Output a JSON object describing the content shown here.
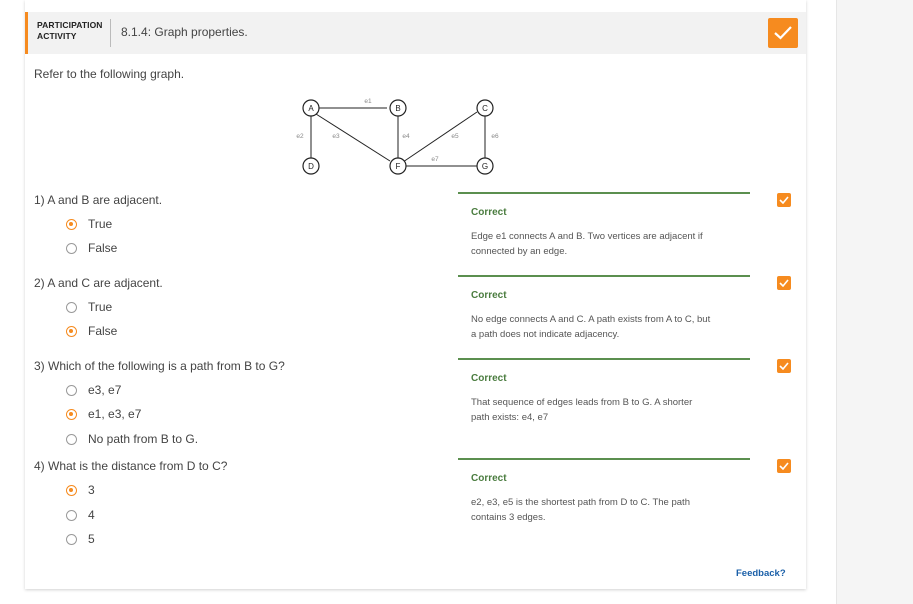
{
  "activity": {
    "label_line1": "PARTICIPATION",
    "label_line2": "ACTIVITY",
    "title": "8.1.4: Graph properties."
  },
  "intro": "Refer to the following graph.",
  "graph": {
    "vertices": [
      "A",
      "B",
      "C",
      "D",
      "F",
      "G"
    ],
    "edges": [
      "e1",
      "e2",
      "e3",
      "e4",
      "e5",
      "e6",
      "e7"
    ]
  },
  "questions": [
    {
      "prompt": "1)  A and B are adjacent.",
      "options": [
        "True",
        "False"
      ],
      "selected": 0,
      "feedback": {
        "title": "Correct",
        "line1": "Edge e1 connects A and B. Two vertices are adjacent if",
        "line2": "connected by an edge."
      }
    },
    {
      "prompt": "2)  A and C are adjacent.",
      "options": [
        "True",
        "False"
      ],
      "selected": 1,
      "feedback": {
        "title": "Correct",
        "line1": "No edge connects A and C. A path exists from A to C, but",
        "line2": "a path does not indicate adjacency."
      }
    },
    {
      "prompt": "3)  Which of the following is a path from B to G?",
      "options": [
        "e3, e7",
        "e1, e3, e7",
        "No path from B to G."
      ],
      "selected": 1,
      "feedback": {
        "title": "Correct",
        "line1": "That sequence of edges leads from B to G. A shorter",
        "line2": "path exists: e4, e7"
      }
    },
    {
      "prompt": "4)  What is the distance from D to C?",
      "options": [
        "3",
        "4",
        "5"
      ],
      "selected": 0,
      "feedback": {
        "title": "Correct",
        "line1": "e2, e3, e5 is the shortest path from D to C. The path",
        "line2": "contains 3 edges."
      }
    }
  ],
  "feedback_link": "Feedback?",
  "colors": {
    "accent": "#f68b1f",
    "correct": "#5b8f4f",
    "link": "#1a5fa8"
  },
  "icons": {
    "complete": "checkmark-icon",
    "question_complete": "checkmark-icon"
  }
}
